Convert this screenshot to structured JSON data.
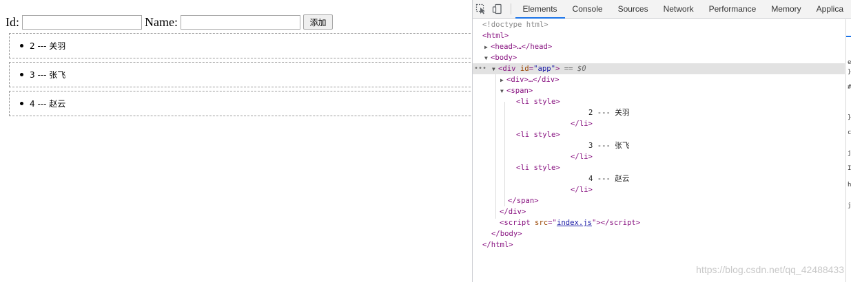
{
  "form": {
    "id_label": "Id:",
    "id_value": "",
    "name_label": "Name:",
    "name_value": "",
    "add_button": "添加"
  },
  "list_items": [
    {
      "text": "2 --- 关羽"
    },
    {
      "text": "3 --- 张飞"
    },
    {
      "text": "4 --- 赵云"
    }
  ],
  "devtools": {
    "tabs": [
      "Elements",
      "Console",
      "Sources",
      "Network",
      "Performance",
      "Memory",
      "Applica"
    ],
    "active_tab": "Elements",
    "dom": {
      "doctype": "<!doctype html>",
      "html_open": "<html>",
      "head": "<head>…</head>",
      "body_open": "<body>",
      "div_app_tag": "div",
      "div_app_attr": "id",
      "div_app_val": "\"app\"",
      "selected_marker": "== $0",
      "inner_div": "<div>…</div>",
      "span_open": "<span>",
      "li_open": "<li style>",
      "li_close": "</li>",
      "li_texts": [
        "2 --- 关羽",
        "3 --- 张飞",
        "4 --- 赵云"
      ],
      "span_close": "</span>",
      "div_close": "</div>",
      "script_src": "index.js",
      "body_close": "</body>",
      "html_close": "</html>"
    },
    "side_chars": [
      "e",
      "}",
      "#",
      "}",
      "c",
      "j",
      "I",
      "h",
      "j"
    ]
  },
  "watermark": "https://blog.csdn.net/qq_42488433"
}
